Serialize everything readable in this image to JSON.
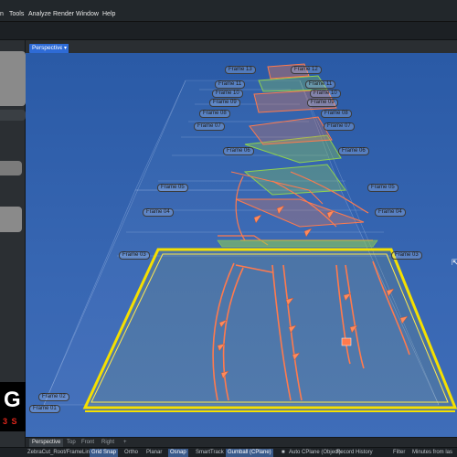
{
  "menubar": {
    "items": [
      "n",
      "Tools",
      "Analyze",
      "Render",
      "Window",
      "Help"
    ]
  },
  "viewport": {
    "tab_label": "Perspective",
    "caret": "▾",
    "frame_labels": [
      {
        "text": "Frame 13"
      },
      {
        "text": "Frame 12"
      },
      {
        "text": "Frame 11"
      },
      {
        "text": "Frame 11"
      },
      {
        "text": "Frame 10"
      },
      {
        "text": "Frame 10"
      },
      {
        "text": "Frame 09"
      },
      {
        "text": "Frame 09"
      },
      {
        "text": "Frame 08"
      },
      {
        "text": "Frame 08"
      },
      {
        "text": "Frame 07"
      },
      {
        "text": "Frame 07"
      },
      {
        "text": "Frame 06"
      },
      {
        "text": "Frame 06"
      },
      {
        "text": "Frame 05"
      },
      {
        "text": "Frame 05"
      },
      {
        "text": "Frame 04"
      },
      {
        "text": "Frame 04"
      },
      {
        "text": "Frame 03"
      },
      {
        "text": "Frame 03"
      },
      {
        "text": "Frame 02"
      },
      {
        "text": "Frame 01"
      }
    ]
  },
  "logo": {
    "letter": "G",
    "sub": "3 S"
  },
  "viewtabs": [
    "Perspective",
    "Top",
    "Front",
    "Right",
    "+"
  ],
  "status": {
    "path": "ZebraCut_Root/FrameLines",
    "grid_snap": "Grid Snap",
    "ortho": "Ortho",
    "planar": "Planar",
    "osnap": "Osnap",
    "smarttrack": "SmartTrack",
    "gumball": "Gumball (CPlane)",
    "auto_cplane": "Auto CPlane (Object)",
    "record_history": "Record History",
    "filter": "Filter",
    "minutes": "Minutes from las"
  },
  "colors": {
    "accent": "#2e6bd6",
    "frame_yellow": "#f5e000",
    "curve_orange": "#ff7a4d",
    "mesh_green": "#8fd14f"
  }
}
